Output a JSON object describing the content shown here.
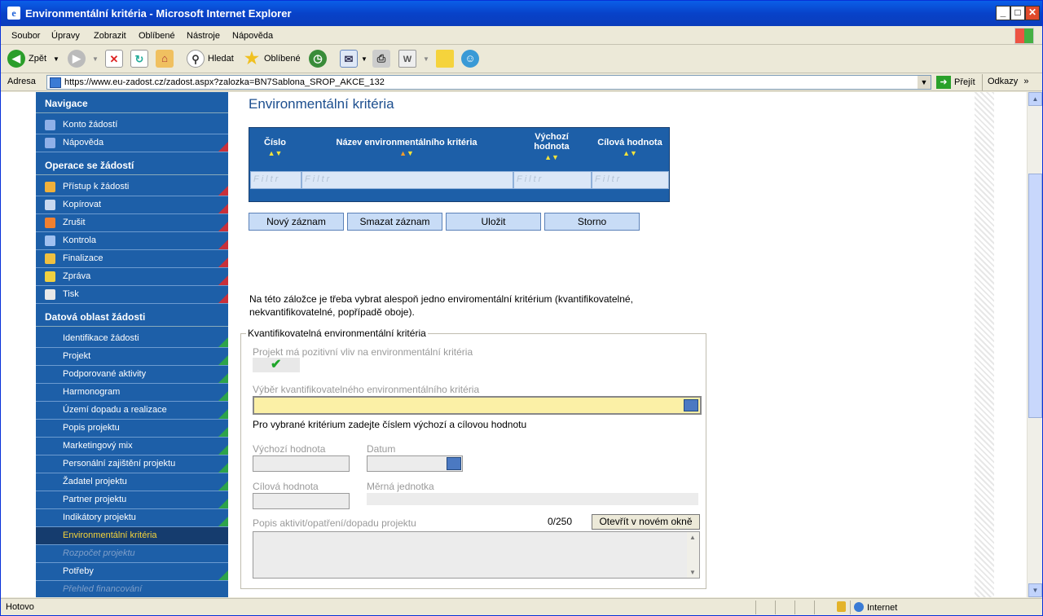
{
  "window": {
    "title": "Environmentální kritéria - Microsoft Internet Explorer"
  },
  "menu": [
    "Soubor",
    "Úpravy",
    "Zobrazit",
    "Oblíbené",
    "Nástroje",
    "Nápověda"
  ],
  "toolbar": {
    "back": "Zpět",
    "search": "Hledat",
    "favorites": "Oblíbené"
  },
  "address": {
    "label": "Adresa",
    "url": "https://www.eu-zadost.cz/zadost.aspx?zalozka=BN7Sablona_SROP_AKCE_132",
    "go": "Přejít",
    "links": "Odkazy"
  },
  "sidebar": {
    "sections": [
      {
        "title": "Navigace",
        "items": [
          {
            "label": "Konto žádostí",
            "icon": "book-icon"
          },
          {
            "label": "Nápověda",
            "icon": "help-icon"
          }
        ]
      },
      {
        "title": "Operace se žádostí",
        "items": [
          {
            "label": "Přístup k žádosti",
            "icon": "users-icon"
          },
          {
            "label": "Kopírovat",
            "icon": "copy-arrow-icon"
          },
          {
            "label": "Zrušit",
            "icon": "delete-icon"
          },
          {
            "label": "Kontrola",
            "icon": "check-icon"
          },
          {
            "label": "Finalizace",
            "icon": "lock-icon"
          },
          {
            "label": "Zpráva",
            "icon": "envelope-icon"
          },
          {
            "label": "Tisk",
            "icon": "print-icon"
          }
        ]
      },
      {
        "title": "Datová oblast žádosti",
        "items": [
          {
            "label": "Identifikace žádosti"
          },
          {
            "label": "Projekt"
          },
          {
            "label": "Podporované aktivity"
          },
          {
            "label": "Harmonogram"
          },
          {
            "label": "Území dopadu a realizace"
          },
          {
            "label": "Popis projektu"
          },
          {
            "label": "Marketingový mix"
          },
          {
            "label": "Personální zajištění projektu"
          },
          {
            "label": "Žadatel projektu"
          },
          {
            "label": "Partner projektu"
          },
          {
            "label": "Indikátory projektu"
          },
          {
            "label": "Environmentální kritéria"
          },
          {
            "label": "Rozpočet projektu"
          },
          {
            "label": "Potřeby"
          },
          {
            "label": "Přehled financování"
          }
        ]
      }
    ]
  },
  "main": {
    "title": "Environmentální kritéria",
    "grid": {
      "columns": [
        {
          "label": "Číslo"
        },
        {
          "label": "Název environmentálního kritéria"
        },
        {
          "label": "Výchozí hodnota"
        },
        {
          "label": "Cílová hodnota"
        }
      ],
      "filter_placeholder": "Filtr"
    },
    "buttons": [
      "Nový záznam",
      "Smazat záznam",
      "Uložit",
      "Storno"
    ],
    "info_text": "Na této záložce je třeba vybrat alespoň jedno enviromentální kritérium (kvantifikovatelné, nekvantifikovatelné, popřípadě oboje).",
    "fieldset": {
      "legend": "Kvantifikovatelná environmentální kritéria",
      "positive_impact_label": "Projekt má pozitivní vliv na environmentální kritéria",
      "positive_impact_checked": true,
      "select_label": "Výběr kvantifikovatelného environmentálního kritéria",
      "instruction": "Pro vybrané kritérium zadejte číslem výchozí a cílovou hodnotu",
      "initial_value_label": "Výchozí hodnota",
      "date_label": "Datum",
      "target_value_label": "Cílová hodnota",
      "unit_label": "Měrná jednotka",
      "description_label": "Popis aktivit/opatření/dopadu projektu",
      "counter": "0/250",
      "open_window": "Otevřít v novém okně"
    }
  },
  "status": {
    "text": "Hotovo",
    "zone": "Internet"
  },
  "colors": {
    "sidebar_bg": "#1d5fa8",
    "active_item": "#f5d43a",
    "select_field": "#fbf0a6",
    "title_blue": "#1d4f8f"
  }
}
